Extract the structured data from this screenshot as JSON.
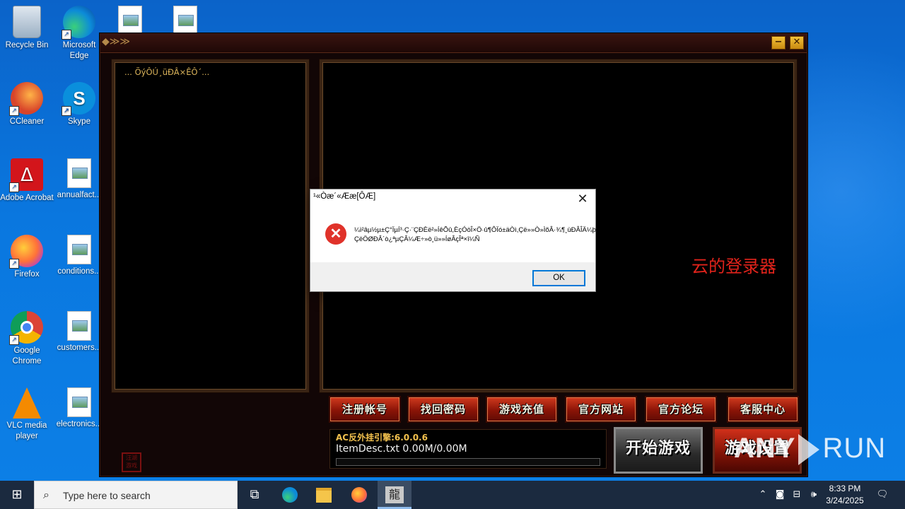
{
  "desktop": {
    "icons": [
      {
        "label": "Recycle Bin"
      },
      {
        "label": "Microsoft Edge"
      },
      {
        "label": "CCleaner"
      },
      {
        "label": "Skype"
      },
      {
        "label": "Adobe Acrobat"
      },
      {
        "label": "annualfact..."
      },
      {
        "label": "Firefox"
      },
      {
        "label": "conditions..."
      },
      {
        "label": "Google Chrome"
      },
      {
        "label": "customers..."
      },
      {
        "label": "VLC media player"
      },
      {
        "label": "electronics..."
      }
    ]
  },
  "game_window": {
    "left_panel_status": "... ÕýÔÚ¸üÐÂ×ÊÔ´...",
    "brand_text": "云的登录器",
    "menu_buttons": [
      "注册帐号",
      "找回密码",
      "游戏充值",
      "官方网站",
      "官方论坛",
      "客服中心"
    ],
    "ac_engine": "AC反外挂引擎:6.0.0.6",
    "download_status": "ItemDesc.txt 0.00M/0.00M",
    "progress": 0,
    "start_button": "开始游戏",
    "settings_button": "游戏设置",
    "seal_text": "汪湖游戏"
  },
  "dialog": {
    "title": "¹«Òæ´«Ææ[ÔÆ]",
    "message": "¼ì²âµ½µ±Ç°ÏµÍ³·Ç·¨ÇÐÈë²»ÍêÕû,ÈçÓöÎ×Ö·û¶ÔÏó±äÒì,Çë»»Ò»ÌõÂ·¾¶¸üÐÂÎÄ¼þ!ÇëÖØÐÂ´ò¿ªµÇÂ¼Æ÷»ò¸ü»»ÍøÂçÎª×î¼Ñ",
    "ok_label": "OK",
    "close_glyph": "✕"
  },
  "watermark": {
    "left": "ANY",
    "right": "RUN"
  },
  "taskbar": {
    "search_placeholder": "Type here to search",
    "game_glyph": "龍",
    "time": "8:33 PM",
    "date": "3/24/2025"
  }
}
